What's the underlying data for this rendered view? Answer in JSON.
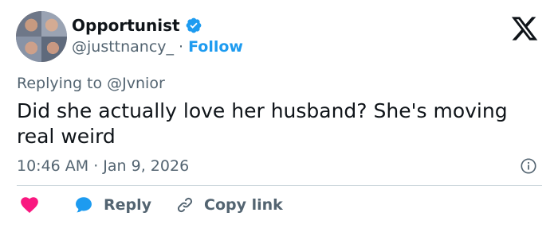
{
  "author": {
    "name": "Opportunist",
    "handle": "@justtnancy_",
    "separator": "·",
    "follow_label": "Follow"
  },
  "reply_context": {
    "prefix": "Replying to",
    "mention": "@Jvnior"
  },
  "tweet": {
    "text": "Did she actually love her husband? She's moving real weird",
    "timestamp": "10:46 AM · Jan 9, 2026"
  },
  "actions": {
    "reply_label": "Reply",
    "copy_link_label": "Copy link"
  },
  "colors": {
    "accent": "#1d9bf0",
    "like": "#f91880",
    "muted_text": "#536471",
    "body_text": "#0f1419",
    "divider": "#cfd9de"
  },
  "icons": [
    "verified-badge-icon",
    "x-logo-icon",
    "info-icon",
    "heart-icon",
    "reply-bubble-icon",
    "link-icon"
  ]
}
